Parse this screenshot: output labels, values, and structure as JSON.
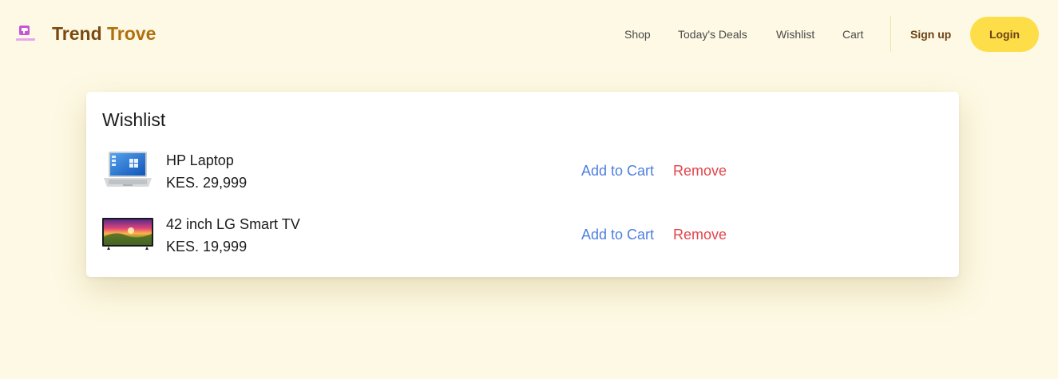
{
  "header": {
    "brand_part1": "Trend ",
    "brand_part2": "Trove",
    "logo_icon": "brand-logo-icon",
    "nav": [
      {
        "label": "Shop"
      },
      {
        "label": "Today's Deals"
      },
      {
        "label": "Wishlist"
      },
      {
        "label": "Cart"
      }
    ],
    "signup_label": "Sign up",
    "login_label": "Login"
  },
  "wishlist": {
    "title": "Wishlist",
    "items": [
      {
        "name": "HP Laptop",
        "price": "KES. 29,999",
        "image_icon": "laptop-image",
        "add_label": "Add to Cart",
        "remove_label": "Remove"
      },
      {
        "name": "42 inch LG Smart TV",
        "price": "KES. 19,999",
        "image_icon": "tv-image",
        "add_label": "Add to Cart",
        "remove_label": "Remove"
      }
    ]
  },
  "colors": {
    "background": "#fef9e4",
    "brand": "#7a4a12",
    "login_button": "#fddd48",
    "add_link": "#4f7fdf",
    "remove_link": "#e3444a"
  }
}
